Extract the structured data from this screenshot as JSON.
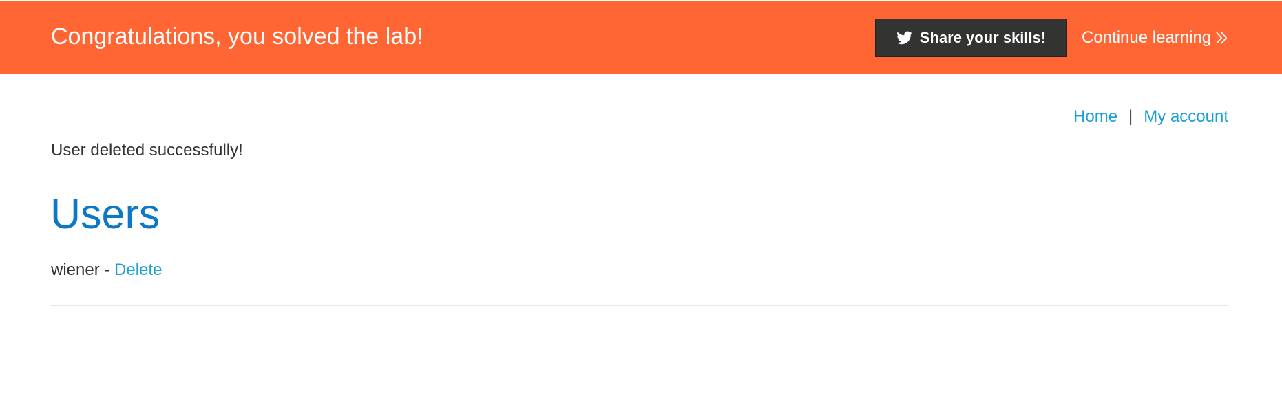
{
  "banner": {
    "title": "Congratulations, you solved the lab!",
    "share_button": {
      "label": "Share your skills!",
      "icon": "twitter-icon"
    },
    "continue_link": {
      "label": "Continue learning",
      "icon": "double-chevron-right-icon"
    },
    "background_color": "#ff6633"
  },
  "top_nav": {
    "home_label": "Home",
    "separator": "|",
    "account_label": "My account",
    "link_color": "#1a9fd8"
  },
  "status": {
    "message": "User deleted successfully!"
  },
  "users_section": {
    "heading": "Users",
    "heading_color": "#0d78c5",
    "users": [
      {
        "username": "wiener",
        "separator": "-",
        "action_label": "Delete"
      }
    ]
  }
}
